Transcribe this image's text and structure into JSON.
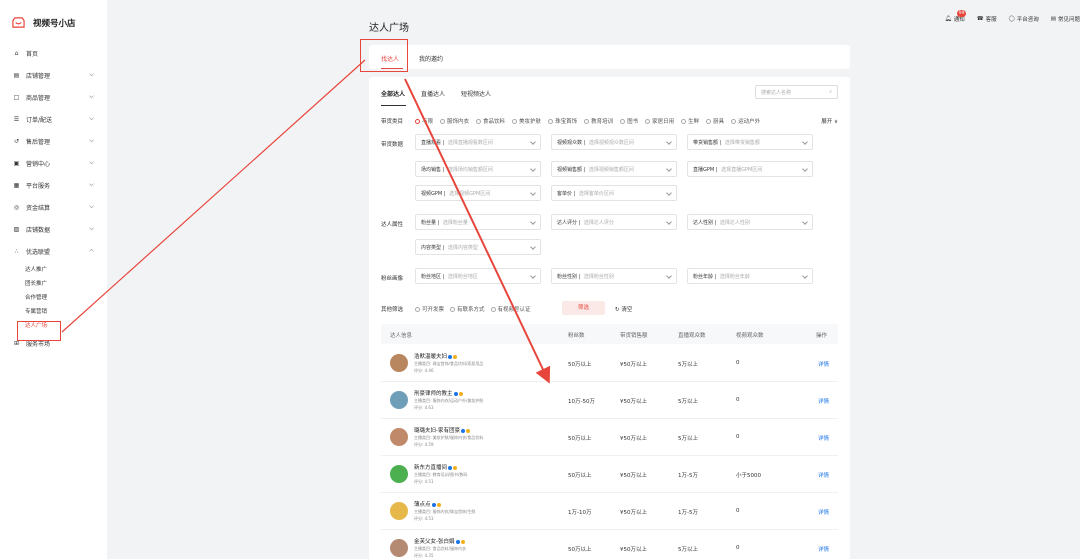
{
  "brand": {
    "name": "视频号小店"
  },
  "sidebar": {
    "items": [
      {
        "label": "首页",
        "icon": "home-icon",
        "chev": false
      },
      {
        "label": "店铺管理",
        "icon": "store-icon",
        "chev": true
      },
      {
        "label": "商品管理",
        "icon": "bag-icon",
        "chev": true
      },
      {
        "label": "订单/配送",
        "icon": "order-icon",
        "chev": true
      },
      {
        "label": "售后管理",
        "icon": "service-icon",
        "chev": true
      },
      {
        "label": "营销中心",
        "icon": "marketing-icon",
        "chev": true
      },
      {
        "label": "平台服务",
        "icon": "platform-icon",
        "chev": true
      },
      {
        "label": "资金结算",
        "icon": "fund-icon",
        "chev": true
      },
      {
        "label": "店铺数据",
        "icon": "data-icon",
        "chev": true
      },
      {
        "label": "优选联盟",
        "icon": "alliance-icon",
        "chev": true
      }
    ],
    "sub_items": [
      "达人推广",
      "团长推广",
      "合作管理",
      "专属营销",
      "达人广场"
    ],
    "last_item": "服务市场"
  },
  "topbar": {
    "notice": "通知",
    "notice_badge": "99",
    "service": "客服",
    "consult": "平台咨询",
    "faq": "常见问题"
  },
  "page_title": "达人广场",
  "tabs": [
    "找达人",
    "我的邀约"
  ],
  "subtabs": [
    "全部达人",
    "直播达人",
    "短视频达人"
  ],
  "search_placeholder": "搜索达人名称",
  "filters": {
    "category_label": "带货类目",
    "categories": [
      "不限",
      "服饰内衣",
      "食品饮料",
      "美妆护肤",
      "珠宝首饰",
      "教育培训",
      "图书",
      "家居日用",
      "生鲜",
      "厨具",
      "运动户外"
    ],
    "expand": "展开",
    "sales_label": "带货数据",
    "sales_selects": [
      {
        "k": "直播观看",
        "ph": "选择直播观看数区间"
      },
      {
        "k": "视频观众数",
        "ph": "选择视频观众数区间"
      },
      {
        "k": "带货销售额",
        "ph": "选择带货销售额"
      },
      {
        "k": "场均销售",
        "ph": "选择场均销售额区间"
      },
      {
        "k": "视频销售额",
        "ph": "选择视频销售额区间"
      },
      {
        "k": "直播GPM",
        "ph": "选择直播GPM区间"
      },
      {
        "k": "视频GPM",
        "ph": "选择视频GPM区间"
      },
      {
        "k": "客单价",
        "ph": "选择客单价区间"
      }
    ],
    "attr_label": "达人属性",
    "attr_selects": [
      {
        "k": "粉丝量",
        "ph": "选择粉丝量"
      },
      {
        "k": "达人评分",
        "ph": "选择达人评分"
      },
      {
        "k": "达人性别",
        "ph": "选择达人性别"
      },
      {
        "k": "内容类型",
        "ph": "选择内容类型"
      }
    ],
    "fan_label": "粉丝画像",
    "fan_selects": [
      {
        "k": "粉丝地区",
        "ph": "选择粉丝地区"
      },
      {
        "k": "粉丝性别",
        "ph": "选择粉丝性别"
      },
      {
        "k": "粉丝年龄",
        "ph": "选择粉丝年龄"
      }
    ],
    "other_label": "其他筛选",
    "checks": [
      "可开发票",
      "有联系方式",
      "有视频号认证"
    ],
    "filter_btn": "筛选",
    "clear_btn": "清空"
  },
  "table": {
    "headers": [
      "达人信息",
      "粉丝数",
      "带货销售额",
      "直播观众数",
      "视频观众数",
      "操作"
    ],
    "rows": [
      {
        "name": "浩默温暖夫妇",
        "cat": "主播类目: 珠宝首饰/食品饮料/家居用品",
        "score": "评分: 4.46",
        "fans": "50万以上",
        "sales": "¥50万以上",
        "live": "5万以上",
        "video": "0",
        "action": "详情",
        "avatar": "#b9875f"
      },
      {
        "name": "刑豪律师的教主",
        "cat": "主播类目: 服饰内衣/运动户外/美妆护肤",
        "score": "评分: 4.63",
        "fans": "10万-50万",
        "sales": "¥50万以上",
        "live": "5万以上",
        "video": "0",
        "action": "详情",
        "avatar": "#6f9fb8"
      },
      {
        "name": "璐璐夫妇-家有团豪",
        "cat": "主播类目: 美妆护肤/服饰内衣/食品饮料",
        "score": "评分: 4.59",
        "fans": "50万以上",
        "sales": "¥50万以上",
        "live": "5万以上",
        "video": "0",
        "action": "详情",
        "avatar": "#c08a6a"
      },
      {
        "name": "新东方直播间",
        "cat": "主播类目: 教育培训/图书/数码",
        "score": "评分: 4.51",
        "fans": "50万以上",
        "sales": "¥50万以上",
        "live": "1万-5万",
        "video": "小于5000",
        "action": "详情",
        "avatar": "#4caf50"
      },
      {
        "name": "薄点点",
        "cat": "主播类目: 服饰内衣/珠宝首饰/生鲜",
        "score": "评分: 4.53",
        "fans": "1万-10万",
        "sales": "¥50万以上",
        "live": "1万-5万",
        "video": "0",
        "action": "详情",
        "avatar": "#e6b84a"
      },
      {
        "name": "金芙父女-张白娟",
        "cat": "主播类目: 食品饮料/服饰内衣",
        "score": "评分: 4.35",
        "fans": "50万以上",
        "sales": "¥50万以上",
        "live": "5万以上",
        "video": "0",
        "action": "详情",
        "avatar": "#b48a72"
      }
    ]
  },
  "colors": {
    "accent": "#e8453c",
    "link": "#1a73e8"
  }
}
